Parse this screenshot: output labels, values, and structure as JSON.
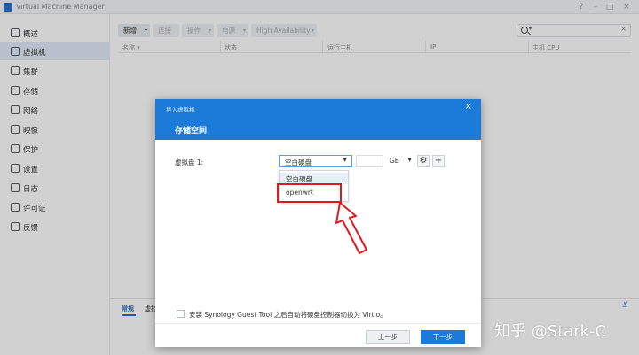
{
  "window": {
    "title": "Virtual Machine Manager",
    "controls": [
      "?",
      "–",
      "□",
      "×"
    ]
  },
  "sidebar": {
    "items": [
      {
        "label": "概述",
        "icon": "overview-icon"
      },
      {
        "label": "虚拟机",
        "icon": "vm-icon",
        "active": true
      },
      {
        "label": "集群",
        "icon": "cluster-icon"
      },
      {
        "label": "存储",
        "icon": "storage-icon"
      },
      {
        "label": "网络",
        "icon": "network-icon"
      },
      {
        "label": "映像",
        "icon": "image-icon"
      },
      {
        "label": "保护",
        "icon": "shield-icon"
      },
      {
        "label": "设置",
        "icon": "gear-icon"
      },
      {
        "label": "日志",
        "icon": "log-icon"
      },
      {
        "label": "许可证",
        "icon": "key-icon"
      },
      {
        "label": "反馈",
        "icon": "feedback-icon"
      }
    ]
  },
  "toolbar": {
    "new_label": "新增",
    "connect_label": "连接",
    "action_label": "操作",
    "power_label": "电源",
    "ha_label": "High Availability"
  },
  "grid": {
    "columns": [
      "名称",
      "状态",
      "运行主机",
      "IP",
      "主机 CPU"
    ]
  },
  "bottom_panel": {
    "tabs": [
      "常规",
      "虚拟"
    ]
  },
  "dialog": {
    "title": "导入虚拟机",
    "step_title": "存储空间",
    "disk_label": "虚拟盘 1:",
    "disk_value": "空白硬盘",
    "unit_value": "GB",
    "options": [
      "空白硬盘",
      "openwrt"
    ],
    "checkbox_label": "安装 Synology Guest Tool 之后自动将硬盘控制器切换为 Virtio。",
    "prev_label": "上一步",
    "next_label": "下一步"
  },
  "watermark": "知乎 @Stark-C",
  "colors": {
    "accent": "#1c7ad9",
    "highlight": "#e0191f"
  }
}
